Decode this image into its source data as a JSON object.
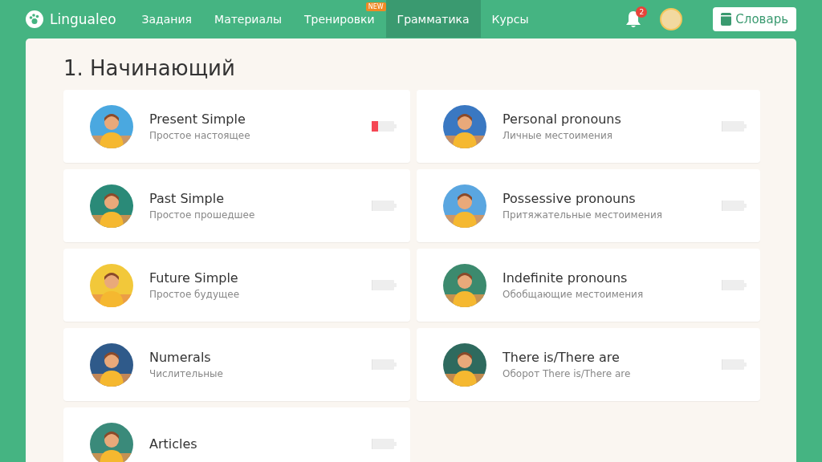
{
  "header": {
    "logo": "Lingualeo",
    "nav": [
      {
        "label": "Задания",
        "selected": false
      },
      {
        "label": "Материалы",
        "selected": false
      },
      {
        "label": "Тренировки",
        "selected": false,
        "badge": "NEW"
      },
      {
        "label": "Грамматика",
        "selected": true
      },
      {
        "label": "Курсы",
        "selected": false
      }
    ],
    "notifications": "2",
    "dictionary_button": "Словарь"
  },
  "section_title": "1. Начинающий",
  "topics": [
    {
      "title": "Present Simple",
      "subtitle": "Простое настоящее",
      "level": 0.3
    },
    {
      "title": "Personal pronouns",
      "subtitle": "Личные местоимения",
      "level": 0
    },
    {
      "title": "Past Simple",
      "subtitle": "Простое прошедшее",
      "level": 0
    },
    {
      "title": "Possessive pronouns",
      "subtitle": "Притяжательные местоимения",
      "level": 0
    },
    {
      "title": "Future Simple",
      "subtitle": "Простое будущее",
      "level": 0
    },
    {
      "title": "Indefinite pronouns",
      "subtitle": "Обобщающие местоимения",
      "level": 0
    },
    {
      "title": "Numerals",
      "subtitle": "Числительные",
      "level": 0
    },
    {
      "title": "There is/There are",
      "subtitle": "Оборот There is/There are",
      "level": 0
    },
    {
      "title": "Articles",
      "level": 0
    }
  ]
}
